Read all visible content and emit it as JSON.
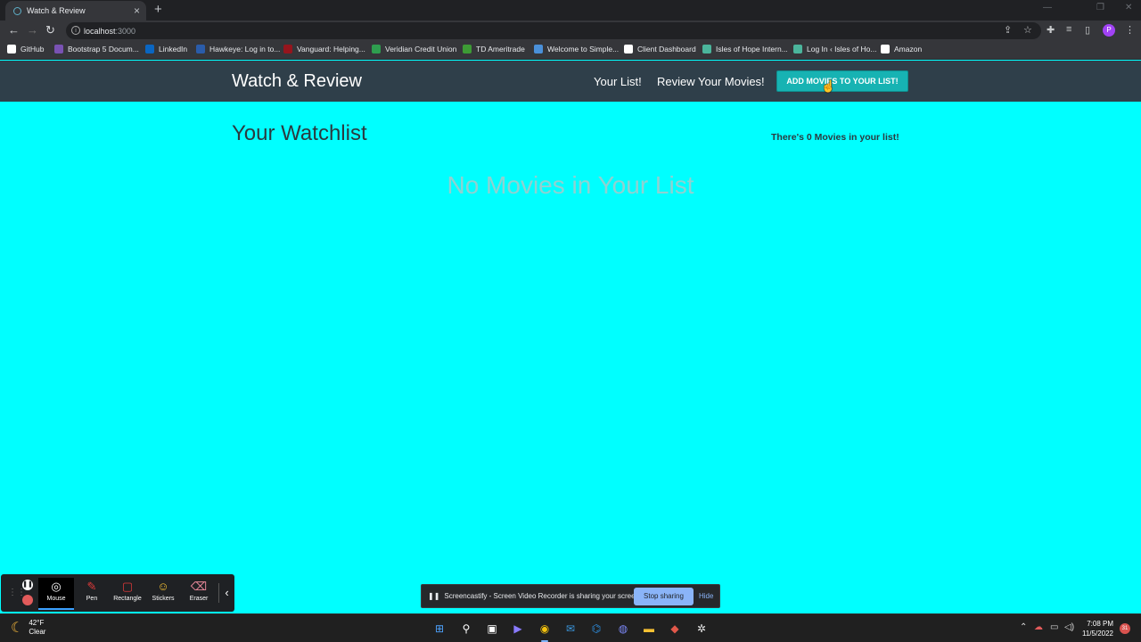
{
  "browser": {
    "tab_title": "Watch & Review",
    "url_host": "localhost",
    "url_port": ":3000",
    "profile_initial": "P",
    "bookmarks": [
      {
        "label": "GitHub",
        "icon": "github-icon",
        "color": "#ffffff"
      },
      {
        "label": "Bootstrap 5 Docum...",
        "icon": "bootstrap-icon",
        "color": "#7952b3"
      },
      {
        "label": "LinkedIn",
        "icon": "linkedin-icon",
        "color": "#0a66c2"
      },
      {
        "label": "Hawkeye: Log in to...",
        "icon": "hawkeye-icon",
        "color": "#2a5caa"
      },
      {
        "label": "Vanguard: Helping...",
        "icon": "vanguard-icon",
        "color": "#96151d"
      },
      {
        "label": "Veridian Credit Union",
        "icon": "veridian-icon",
        "color": "#2e9e4f"
      },
      {
        "label": "TD Ameritrade",
        "icon": "td-icon",
        "color": "#3d9b35"
      },
      {
        "label": "Welcome to Simple...",
        "icon": "simple-icon",
        "color": "#4a90d9"
      },
      {
        "label": "Client Dashboard",
        "icon": "client-icon",
        "color": "#ffffff"
      },
      {
        "label": "Isles of Hope Intern...",
        "icon": "isles-icon",
        "color": "#4bb59c"
      },
      {
        "label": "Log In ‹ Isles of Ho...",
        "icon": "isles-icon",
        "color": "#4bb59c"
      },
      {
        "label": "Amazon",
        "icon": "amazon-icon",
        "color": "#ffffff"
      }
    ]
  },
  "app": {
    "brand": "Watch & Review",
    "nav_your_list": "Your List!",
    "nav_review": "Review Your Movies!",
    "add_button": "ADD MOVIES TO YOUR LIST!",
    "page_title": "Your Watchlist",
    "count_text": "There's 0 Movies in your list!",
    "empty_text": "No Movies in Your List",
    "colors": {
      "navbar": "#2f3f4a",
      "background": "#00ffff",
      "accent": "#17b3b3"
    }
  },
  "screencastify": {
    "tools": [
      "Mouse",
      "Pen",
      "Rectangle",
      "Stickers",
      "Eraser"
    ],
    "active_tool": "Mouse",
    "share_message": "Screencastify - Screen Video Recorder is sharing your screen.",
    "stop_sharing": "Stop sharing",
    "hide": "Hide"
  },
  "taskbar": {
    "temperature": "42°F",
    "condition": "Clear",
    "time": "7:08 PM",
    "date": "11/5/2022",
    "notifications": "31"
  }
}
